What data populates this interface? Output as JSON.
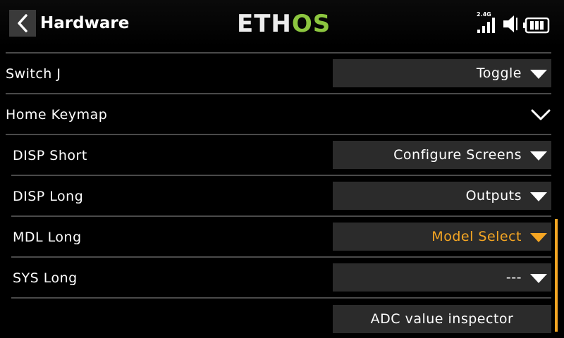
{
  "header": {
    "title": "Hardware",
    "logo_main": "ETH",
    "logo_accent": "OS",
    "band_label": "2.4G"
  },
  "rows": {
    "switch_j": {
      "label": "Switch J",
      "value": "Toggle"
    },
    "home_keymap": {
      "label": "Home Keymap"
    },
    "disp_short": {
      "label": "DISP Short",
      "value": "Configure Screens"
    },
    "disp_long": {
      "label": "DISP Long",
      "value": "Outputs"
    },
    "mdl_long": {
      "label": "MDL Long",
      "value": "Model Select"
    },
    "sys_long": {
      "label": "SYS Long",
      "value": "---"
    }
  },
  "adc_button_label": "ADC value inspector",
  "colors": {
    "accent": "#f5a623",
    "logo_green": "#8cc63f",
    "field_bg": "#2b2b2b"
  },
  "icons": [
    "back-chevron-icon",
    "signal-bars-icon",
    "speaker-icon",
    "battery-icon",
    "chevron-down-icon",
    "dropdown-triangle-icon"
  ]
}
